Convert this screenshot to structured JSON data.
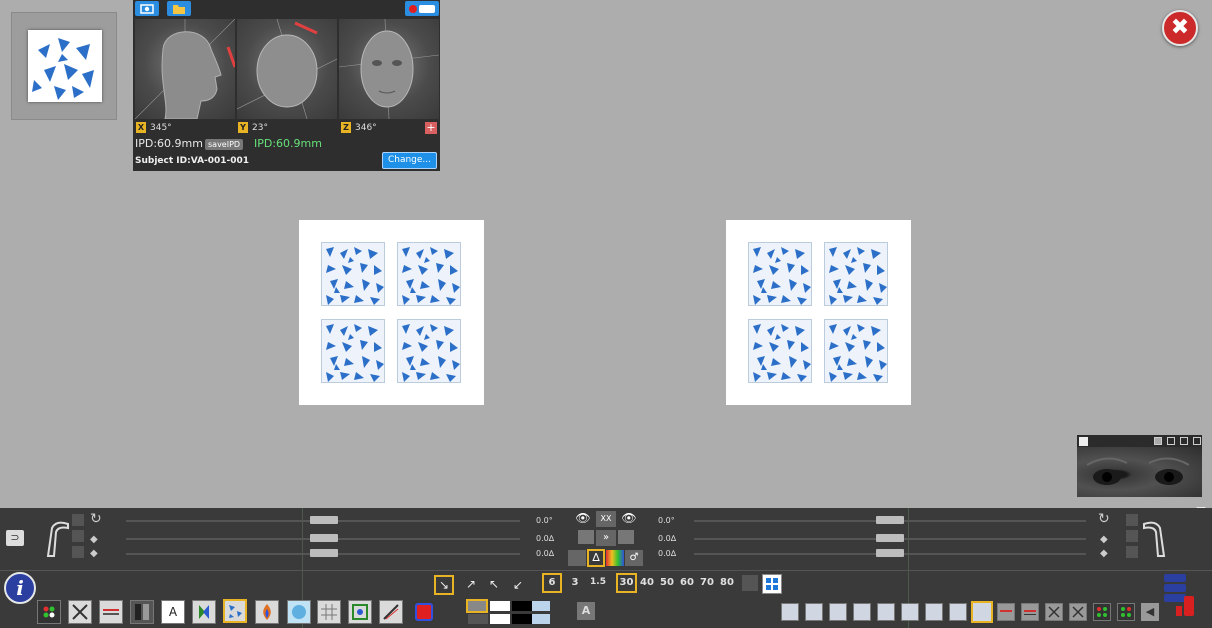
{
  "head_panel": {
    "axes": [
      {
        "axis": "X",
        "value": "345°"
      },
      {
        "axis": "Y",
        "value": "23°"
      },
      {
        "axis": "Z",
        "value": "346°"
      }
    ],
    "ipd": "IPD:60.9mm",
    "save_ipd_label": "saveIPD",
    "ipd_saved": "IPD:60.9mm",
    "subject": "Subject ID:VA-001-001",
    "change_label": "Change..."
  },
  "close_label": "✖",
  "bottom": {
    "left_values": [
      "0.0°",
      "0.0∆",
      "0.0∆"
    ],
    "right_values": [
      "0.0°",
      "0.0∆",
      "0.0∆"
    ],
    "eye_toggle_label": "XX",
    "distance_a": [
      "6",
      "3",
      "1.5"
    ],
    "distance_b": [
      "30",
      "40",
      "50",
      "60",
      "70",
      "80"
    ],
    "letter_label": "A",
    "info_label": "i",
    "tool_a_label": "A"
  },
  "colors": {
    "accent": "#e8b424",
    "blue": "#2a8de0",
    "close": "#cc2a2a",
    "pattern": "#2b6fc8"
  }
}
